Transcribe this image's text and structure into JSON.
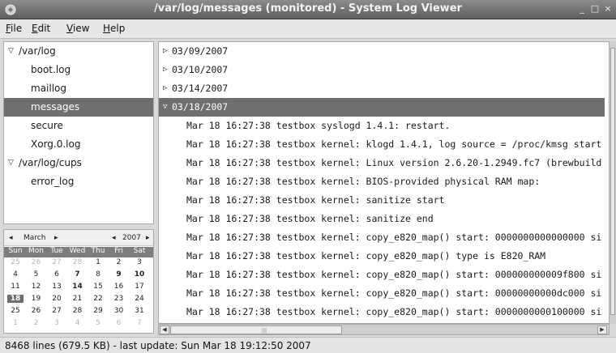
{
  "window": {
    "title": "/var/log/messages (monitored) - System Log Viewer",
    "controls": [
      "_",
      "□",
      "×"
    ]
  },
  "menu": {
    "items": [
      {
        "label": "File",
        "mnemonic": "F",
        "rest": "ile"
      },
      {
        "label": "Edit",
        "mnemonic": "E",
        "rest": "dit"
      },
      {
        "label": "View",
        "mnemonic": "V",
        "rest": "iew"
      },
      {
        "label": "Help",
        "mnemonic": "H",
        "rest": "elp"
      }
    ]
  },
  "logtree": {
    "items": [
      {
        "label": "/var/log",
        "level": 0,
        "expanded": true,
        "selected": false
      },
      {
        "label": "boot.log",
        "level": 1,
        "selected": false
      },
      {
        "label": "maillog",
        "level": 1,
        "selected": false
      },
      {
        "label": "messages",
        "level": 1,
        "selected": true
      },
      {
        "label": "secure",
        "level": 1,
        "selected": false
      },
      {
        "label": "Xorg.0.log",
        "level": 1,
        "selected": false
      },
      {
        "label": "/var/log/cups",
        "level": 0,
        "expanded": true,
        "selected": false
      },
      {
        "label": "error_log",
        "level": 1,
        "selected": false
      }
    ]
  },
  "calendar": {
    "month": "March",
    "year": "2007",
    "prev_arrow": "◂",
    "next_arrow": "▸",
    "weekdays": [
      "Sun",
      "Mon",
      "Tue",
      "Wed",
      "Thu",
      "Fri",
      "Sat"
    ],
    "weeks": [
      [
        {
          "d": "25",
          "dim": true
        },
        {
          "d": "26",
          "dim": true
        },
        {
          "d": "27",
          "dim": true
        },
        {
          "d": "28",
          "dim": true
        },
        {
          "d": "1"
        },
        {
          "d": "2"
        },
        {
          "d": "3"
        }
      ],
      [
        {
          "d": "4"
        },
        {
          "d": "5"
        },
        {
          "d": "6"
        },
        {
          "d": "7",
          "bold": true
        },
        {
          "d": "8"
        },
        {
          "d": "9",
          "bold": true
        },
        {
          "d": "10",
          "bold": true
        }
      ],
      [
        {
          "d": "11"
        },
        {
          "d": "12"
        },
        {
          "d": "13"
        },
        {
          "d": "14",
          "bold": true
        },
        {
          "d": "15"
        },
        {
          "d": "16"
        },
        {
          "d": "17"
        }
      ],
      [
        {
          "d": "18",
          "today": true
        },
        {
          "d": "19"
        },
        {
          "d": "20"
        },
        {
          "d": "21"
        },
        {
          "d": "22"
        },
        {
          "d": "23"
        },
        {
          "d": "24"
        }
      ],
      [
        {
          "d": "25"
        },
        {
          "d": "26"
        },
        {
          "d": "27"
        },
        {
          "d": "28"
        },
        {
          "d": "29"
        },
        {
          "d": "30"
        },
        {
          "d": "31"
        }
      ],
      [
        {
          "d": "1",
          "dim": true
        },
        {
          "d": "2",
          "dim": true
        },
        {
          "d": "3",
          "dim": true
        },
        {
          "d": "4",
          "dim": true
        },
        {
          "d": "5",
          "dim": true
        },
        {
          "d": "6",
          "dim": true
        },
        {
          "d": "7",
          "dim": true
        }
      ]
    ]
  },
  "log": {
    "rows": [
      {
        "kind": "date",
        "text": "03/09/2007",
        "expanded": false
      },
      {
        "kind": "date",
        "text": "03/10/2007",
        "expanded": false
      },
      {
        "kind": "date",
        "text": "03/14/2007",
        "expanded": false
      },
      {
        "kind": "date",
        "text": "03/18/2007",
        "expanded": true,
        "selected": true
      },
      {
        "kind": "msg",
        "text": "Mar 18 16:27:38 testbox syslogd 1.4.1: restart."
      },
      {
        "kind": "msg",
        "text": "Mar 18 16:27:38 testbox kernel: klogd 1.4.1, log source = /proc/kmsg start"
      },
      {
        "kind": "msg",
        "text": "Mar 18 16:27:38 testbox kernel: Linux version 2.6.20-1.2949.fc7 (brewbuild"
      },
      {
        "kind": "msg",
        "text": "Mar 18 16:27:38 testbox kernel: BIOS-provided physical RAM map:"
      },
      {
        "kind": "msg",
        "text": "Mar 18 16:27:38 testbox kernel: sanitize start"
      },
      {
        "kind": "msg",
        "text": "Mar 18 16:27:38 testbox kernel: sanitize end"
      },
      {
        "kind": "msg",
        "text": "Mar 18 16:27:38 testbox kernel: copy_e820_map() start: 0000000000000000 si"
      },
      {
        "kind": "msg",
        "text": "Mar 18 16:27:38 testbox kernel: copy_e820_map() type is E820_RAM"
      },
      {
        "kind": "msg",
        "text": "Mar 18 16:27:38 testbox kernel: copy_e820_map() start: 000000000009f800 si"
      },
      {
        "kind": "msg",
        "text": "Mar 18 16:27:38 testbox kernel: copy_e820_map() start: 00000000000dc000 si"
      },
      {
        "kind": "msg",
        "text": "Mar 18 16:27:38 testbox kernel: copy_e820_map() start: 0000000000100000 si"
      },
      {
        "kind": "msg",
        "text": "Mar 18 16:27:38 testbox kernel: copy_e820_map() type is E820_RAM"
      }
    ]
  },
  "status": {
    "text": "8468 lines (679.5 KB) - last update: Sun Mar 18 19:12:50 2007"
  }
}
